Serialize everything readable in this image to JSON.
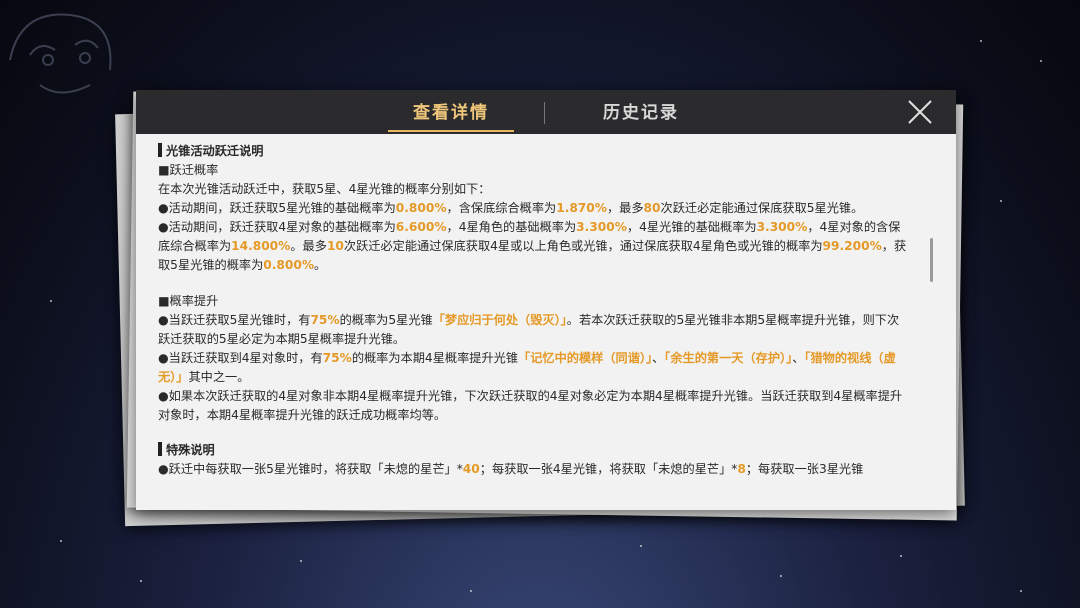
{
  "tabs": {
    "details": "查看详情",
    "history": "历史记录"
  },
  "icons": {
    "close": "close-icon"
  },
  "colors": {
    "accent": "#e59a28",
    "tab_active": "#f0c77a",
    "header_bg": "#2b2b2e"
  },
  "content": {
    "title": "光锥活动跃迁说明",
    "rate_head": "■跃迁概率",
    "intro": "在本次光锥活动跃迁中，获取5星、4星光锥的概率分别如下：",
    "b1": {
      "t1": "●活动期间，跃迁获取5星光锥的基础概率为",
      "v1": "0.800%",
      "t2": "，含保底综合概率为",
      "v2": "1.870%",
      "t3": "，最多",
      "v3": "80",
      "t4": "次跃迁必定能通过保底获取5星光锥。"
    },
    "b2": {
      "t1": "●活动期间，跃迁获取4星对象的基础概率为",
      "v1": "6.600%",
      "t2": "，4星角色的基础概率为",
      "v2": "3.300%",
      "t3": "，4星光锥的基础概率为",
      "v3": "3.300%",
      "t4": "，4星对象的含保底综合概率为",
      "v4": "14.800%",
      "t5": "。最多",
      "v5": "10",
      "t6": "次跃迁必定能通过保底获取4星或以上角色或光锥，通过保底获取4星角色或光锥的概率为",
      "v6": "99.200%",
      "t7": "，获取5星光锥的概率为",
      "v7": "0.800%",
      "t8": "。"
    },
    "up_head": "■概率提升",
    "b3": {
      "t1": "●当跃迁获取5星光锥时，有",
      "v1": "75%",
      "t2": "的概率为5星光锥",
      "v2": "「梦应归于何处（毁灭）」",
      "t3": "。若本次跃迁获取的5星光锥非本期5星概率提升光锥，则下次跃迁获取的5星必定为本期5星概率提升光锥。"
    },
    "b4": {
      "t1": "●当跃迁获取到4星对象时，有",
      "v1": "75%",
      "t2": "的概率为本期4星概率提升光锥",
      "v2": "「记忆中的模样（同谐）」",
      "t3": "、",
      "v3": "「余生的第一天（存护）」",
      "t4": "、",
      "v4": "「猎物的视线（虚无）」",
      "t5": "其中之一。"
    },
    "b5": "●如果本次跃迁获取的4星对象非本期4星概率提升光锥，下次跃迁获取的4星对象必定为本期4星概率提升光锥。当跃迁获取到4星概率提升对象时，本期4星概率提升光锥的跃迁成功概率均等。",
    "special_head": "特殊说明",
    "b6": {
      "t1": "●跃迁中每获取一张5星光锥时，将获取「未熄的星芒」*",
      "v1": "40",
      "t2": "；每获取一张4星光锥，将获取「未熄的星芒」*",
      "v2": "8",
      "t3": "；每获取一张3星光锥"
    }
  }
}
